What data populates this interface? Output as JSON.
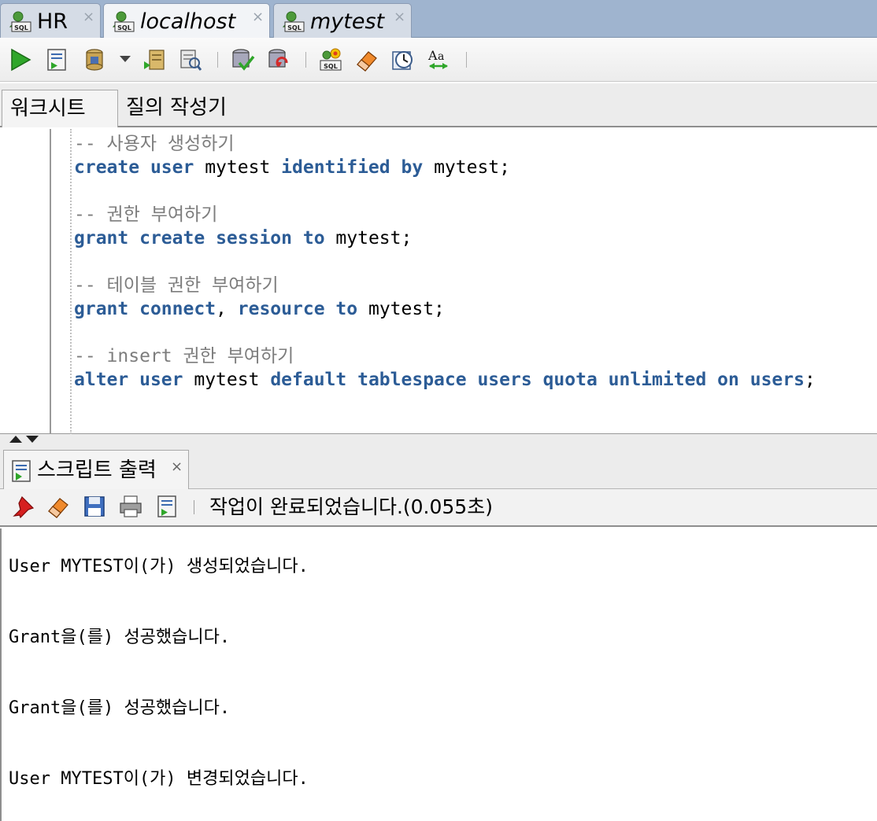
{
  "connection_tabs": [
    {
      "label": "HR",
      "italic": false,
      "active": false
    },
    {
      "label": "localhost",
      "italic": true,
      "active": true
    },
    {
      "label": "mytest",
      "italic": true,
      "active": false
    }
  ],
  "close_glyph": "×",
  "worksheet_tabs": [
    "워크시트",
    "질의 작성기"
  ],
  "code": {
    "comment1": "-- 사용자 생성하기",
    "line1": {
      "k1": "create",
      "k2": "user",
      "u1": "mytest",
      "k3": "identified",
      "k4": "by",
      "u2": "mytest;"
    },
    "comment2": "-- 권한 부여하기",
    "line2": {
      "k1": "grant",
      "k2": "create",
      "k3": "session",
      "k4": "to",
      "u1": "mytest;"
    },
    "comment3": "-- 테이블 권한 부여하기",
    "line3": {
      "k1": "grant",
      "k2": "connect",
      "p1": ",",
      "k3": "resource",
      "k4": "to",
      "u1": "mytest;"
    },
    "comment4": "-- insert 권한 부여하기",
    "line4": {
      "k1": "alter",
      "k2": "user",
      "u1": "mytest",
      "k3": "default",
      "k4": "tablespace",
      "k5": "users",
      "k6": "quota",
      "k7": "unlimited",
      "k8": "on",
      "k9": "users",
      "p1": ";"
    }
  },
  "output_panel": {
    "tab_label": "스크립트 출력",
    "status": "작업이 완료되었습니다.(0.055초)",
    "lines": [
      "User MYTEST이(가) 생성되었습니다.",
      "Grant을(를) 성공했습니다.",
      "Grant을(를) 성공했습니다.",
      "User MYTEST이(가) 변경되었습니다."
    ]
  },
  "colors": {
    "keyword": "#2c5c96",
    "comment": "#7d7d7d",
    "tab_bar": "#9fb4cf"
  }
}
